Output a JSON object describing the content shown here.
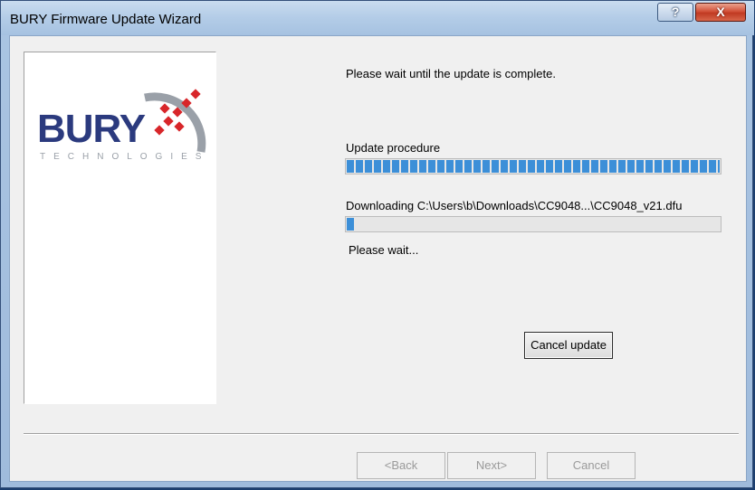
{
  "window": {
    "title": "BURY Firmware Update Wizard",
    "help_glyph": "?",
    "close_glyph": "X"
  },
  "logo": {
    "word": "BURY",
    "tagline": "TECHNOLOGIES"
  },
  "content": {
    "wait_message": "Please wait until the update is complete.",
    "procedure_label": "Update procedure",
    "procedure_progress": 1.0,
    "download_label": "Downloading C:\\Users\\b\\Downloads\\CC9048...\\CC9048_v21.dfu",
    "download_progress": 0.025,
    "status": "Please wait...",
    "cancel_update_label": "Cancel update"
  },
  "footer": {
    "back_label": "<Back",
    "next_label": "Next>",
    "cancel_label": "Cancel"
  },
  "colors": {
    "progress": "#3c8fd8",
    "logo_blue": "#2b3a7e",
    "logo_red": "#d8262a",
    "logo_grey": "#9aa0a8"
  },
  "icons": {
    "help": "help-icon",
    "close": "close-icon",
    "logo": "bury-logo-mark"
  }
}
